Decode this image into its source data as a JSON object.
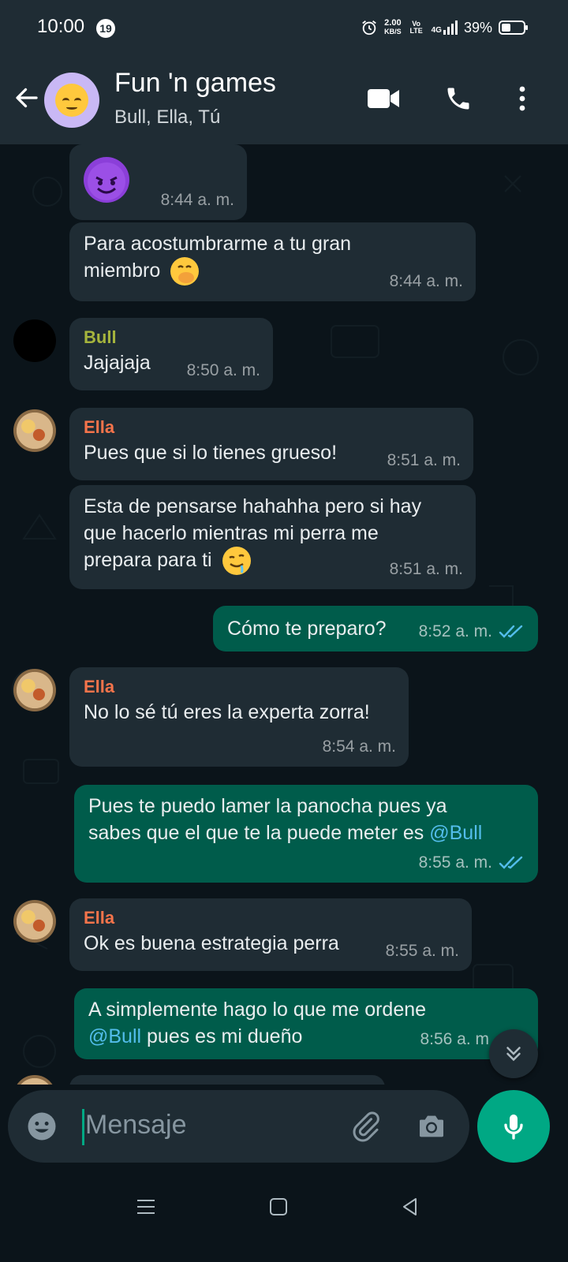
{
  "status": {
    "time": "10:00",
    "notif_count": "19",
    "speed": "2.00",
    "speed_unit": "KB/S",
    "volte": "Vo LTE",
    "network": "4G",
    "battery": "39%"
  },
  "header": {
    "title": "Fun 'n games",
    "subtitle": "Bull, Ella, Tú"
  },
  "messages": [
    {
      "type": "in",
      "text": "",
      "emoji": "smiling-devil",
      "time": "8:44 a. m."
    },
    {
      "type": "in",
      "text_lines": [
        "Para acostumbrarme a tu gran",
        "miembro"
      ],
      "emoji": "face-with-hand-over-mouth",
      "time": "8:44 a. m."
    },
    {
      "type": "in",
      "sender": "Bull",
      "sender_color": "#a6b53d",
      "text": "Jajajaja",
      "time": "8:50 a. m."
    },
    {
      "type": "in",
      "sender": "Ella",
      "sender_color": "#f5744b",
      "text": "Pues que si lo tienes grueso!",
      "time": "8:51 a. m."
    },
    {
      "type": "in",
      "text_lines": [
        "Esta de pensarse hahahha pero si hay",
        "que hacerlo mientras mi perra me",
        "prepara para ti"
      ],
      "emoji": "drooling-face",
      "time": "8:51 a. m."
    },
    {
      "type": "out",
      "text": "Cómo te preparo?",
      "time": "8:52 a. m."
    },
    {
      "type": "in",
      "sender": "Ella",
      "sender_color": "#f5744b",
      "text": "No lo sé tú eres la experta zorra!",
      "time": "8:54 a. m."
    },
    {
      "type": "out",
      "text_lines": [
        "Pues te puedo lamer la panocha pues ya",
        "sabes que el que te la puede meter es "
      ],
      "mention": "@Bull",
      "time": "8:55 a. m."
    },
    {
      "type": "in",
      "sender": "Ella",
      "sender_color": "#f5744b",
      "text": "Ok es buena estrategia perra",
      "time": "8:55 a. m."
    },
    {
      "type": "out",
      "text_line1": "A simplemente hago lo que me ordene",
      "mention": "@Bull",
      "text_line2_rest": " pues es mi dueño",
      "time": "8:56 a. m"
    }
  ],
  "input": {
    "placeholder": "Mensaje"
  },
  "colors": {
    "header_bg": "#1f2c34",
    "chat_bg": "#0b141a",
    "incoming_bg": "#1f2c34",
    "outgoing_bg": "#005c4b",
    "accent": "#00a884",
    "read_tick": "#53bdeb"
  }
}
